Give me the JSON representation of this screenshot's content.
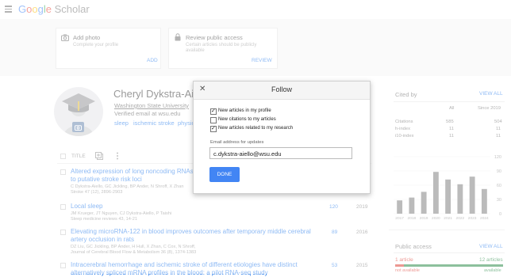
{
  "header": {
    "logo_google": "Google",
    "logo_scholar": "Scholar"
  },
  "cards": {
    "add_photo": {
      "title": "Add photo",
      "subtitle": "Complete your profile",
      "action": "ADD"
    },
    "review_access": {
      "title": "Review public access",
      "subtitle_line1": "Certain articles should be publicly",
      "subtitle_line2": "available",
      "action": "REVIEW"
    }
  },
  "profile": {
    "name": "Cheryl Dykstra-Aiello",
    "affiliation": "Washington State University",
    "email": "Verified email at wsu.edu",
    "keywords": [
      "sleep",
      "ischemic stroke",
      "physiol"
    ]
  },
  "list": {
    "title_header": "TITLE",
    "articles": [
      {
        "title_line1": "Altered expression of long noncoding RNAs in",
        "title_line2": "to putative stroke risk loci",
        "authors": "C Dykstra-Aiello, GC Jickling, BP Ander, N Shroff, X Zhan",
        "venue": "Stroke 47 (12), 2896-2903",
        "cited": "",
        "year": ""
      },
      {
        "title_line1": "Local sleep",
        "title_line2": "",
        "authors": "JM Krueger, JT Nguyen, CJ Dykstra-Aiello, P Taishi",
        "venue": "Sleep medicine reviews 43, 14-21",
        "cited": "120",
        "year": "2019"
      },
      {
        "title_line1": "Elevating microRNA-122 in blood improves outcomes after temporary middle cerebral",
        "title_line2": "artery occlusion in rats",
        "authors": "DZ Liu, GC Jickling, BP Ander, H Hull, X Zhan, C Cox, N Shroff,",
        "venue": "Journal of Cerebral Blood Flow & Metabolism 36 (8), 1374-1383",
        "cited": "89",
        "year": "2016"
      },
      {
        "title_line1": "Intracerebral hemorrhage and ischemic stroke of different etiologies have distinct",
        "title_line2": "alternatively spliced mRNA profiles in the blood: a pilot RNA-seq study",
        "authors": "",
        "venue": "",
        "cited": "53",
        "year": "2015"
      }
    ]
  },
  "cited_by": {
    "title": "Cited by",
    "view_all": "VIEW ALL",
    "col_all": "All",
    "col_since": "Since 2019",
    "rows": [
      {
        "label": "Citations",
        "all": "585",
        "since": "504"
      },
      {
        "label": "h-index",
        "all": "11",
        "since": "11"
      },
      {
        "label": "i10-index",
        "all": "11",
        "since": "11"
      }
    ]
  },
  "chart_data": {
    "type": "bar",
    "categories": [
      "2017",
      "2018",
      "2019",
      "2020",
      "2021",
      "2022",
      "2023",
      "2024"
    ],
    "values": [
      28,
      34,
      46,
      88,
      72,
      62,
      78,
      52
    ],
    "ylim": [
      0,
      120
    ],
    "yticks": [
      "120",
      "90",
      "60",
      "30",
      "0"
    ],
    "bar_color": "#777777"
  },
  "public_access": {
    "title": "Public access",
    "view_all": "VIEW ALL",
    "left": "1 article",
    "right": "12 articles",
    "left_sub": "not available",
    "right_sub": "available",
    "bar_red": "#d93025",
    "bar_green": "#188038"
  },
  "dialog": {
    "title": "Follow",
    "close": "✕",
    "options": [
      {
        "label": "New articles in my profile",
        "checked": true
      },
      {
        "label": "New citations to my articles",
        "checked": false
      },
      {
        "label": "New articles related to my research",
        "checked": true
      }
    ],
    "email_label": "Email address for updates",
    "email_value": "c.dykstra-aiello@wsu.edu",
    "done": "DONE",
    "accent": "#4285f4"
  }
}
